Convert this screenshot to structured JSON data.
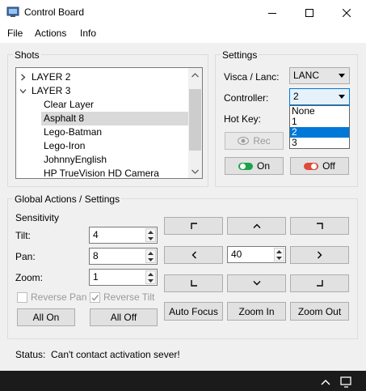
{
  "window": {
    "title": "Control Board",
    "minimize_label": "minimize",
    "maximize_label": "maximize",
    "close_label": "close"
  },
  "menu": {
    "file": "File",
    "actions": "Actions",
    "info": "Info"
  },
  "shots": {
    "group_label": "Shots",
    "items": [
      {
        "label": "LAYER 2",
        "level": 0,
        "expander": "collapsed"
      },
      {
        "label": "LAYER 3",
        "level": 0,
        "expander": "expanded"
      },
      {
        "label": "Clear Layer",
        "level": 1
      },
      {
        "label": "Asphalt 8",
        "level": 1,
        "selected": true
      },
      {
        "label": "Lego-Batman",
        "level": 1
      },
      {
        "label": "Lego-Iron",
        "level": 1
      },
      {
        "label": "JohnnyEnglish",
        "level": 1
      },
      {
        "label": "HP TrueVision HD Camera",
        "level": 1
      }
    ]
  },
  "settings": {
    "group_label": "Settings",
    "visca_label": "Visca / Lanc:",
    "visca_value": "LANC",
    "controller_label": "Controller:",
    "controller_value": "2",
    "controller_options": [
      "None",
      "1",
      "2",
      "3"
    ],
    "controller_selected_option": "2",
    "hotkey_label": "Hot Key:",
    "rec_label": "Rec",
    "on_label": "On",
    "off_label": "Off",
    "on_color": "#1aa34a",
    "off_color": "#e04a3c"
  },
  "global": {
    "group_label": "Global Actions / Settings",
    "sensitivity_label": "Sensitivity",
    "tilt_label": "Tilt:",
    "tilt_value": "4",
    "pan_label": "Pan:",
    "pan_value": "8",
    "zoom_label": "Zoom:",
    "zoom_value": "1",
    "reverse_pan_label": "Reverse Pan",
    "reverse_pan_checked": false,
    "reverse_tilt_label": "Reverse Tilt",
    "reverse_tilt_checked": true,
    "all_on_label": "All On",
    "all_off_label": "All Off",
    "speed_value": "40",
    "auto_focus_label": "Auto Focus",
    "zoom_in_label": "Zoom In",
    "zoom_out_label": "Zoom Out",
    "direction_icons": [
      "arrow-up-left-icon",
      "arrow-up-icon",
      "arrow-up-right-icon",
      "arrow-left-icon",
      "arrow-right-icon",
      "arrow-down-left-icon",
      "arrow-down-icon",
      "arrow-down-right-icon"
    ]
  },
  "status": {
    "label": "Status:",
    "message": "Can't contact activation sever!"
  },
  "taskbar": {
    "icons": [
      "chevron-up-icon",
      "network-icon"
    ]
  },
  "colors": {
    "accent": "#0078d7",
    "window_bg": "#f0f0f0",
    "selection_gray": "#d9d9d9"
  }
}
